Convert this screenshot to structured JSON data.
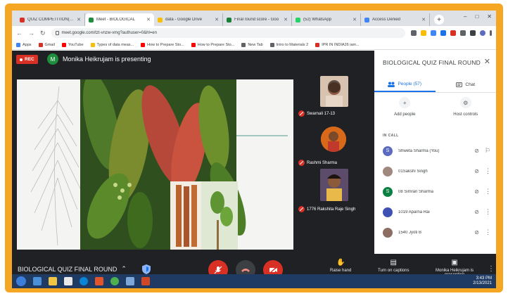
{
  "browser": {
    "tabs": [
      {
        "title": "QUIZ COMPETITION(UG)",
        "favicon_color": "#d93025",
        "active": false
      },
      {
        "title": "Meet - BIOLOGICAL",
        "favicon_color": "#1e8e3e",
        "active": true
      },
      {
        "title": "data - Google Drive",
        "favicon_color": "#fbbc04",
        "active": false
      },
      {
        "title": "Final round score - Goo",
        "favicon_color": "#188038",
        "active": false
      },
      {
        "title": "(52) WhatsApp",
        "favicon_color": "#25d366",
        "active": false
      },
      {
        "title": "Access Denied",
        "favicon_color": "#4285f4",
        "active": false
      }
    ],
    "new_tab_label": "+",
    "url": "meet.google.com/tzt-vnzw-vmg?authuser=0&hl=en",
    "bookmarks": [
      {
        "label": "Apps",
        "color": "#4285f4"
      },
      {
        "label": "Gmail",
        "color": "#d93025"
      },
      {
        "label": "YouTube",
        "color": "#ff0000"
      },
      {
        "label": "Types of data meas...",
        "color": "#fbbc04"
      },
      {
        "label": "How to Prepare Sto...",
        "color": "#ff0000"
      },
      {
        "label": "How to Prepare Sto...",
        "color": "#ff0000"
      },
      {
        "label": "New Tab",
        "color": "#5f6368"
      },
      {
        "label": "Intro to Materials 2",
        "color": "#5f6368"
      },
      {
        "label": "IPR IN INDIA26 iam...",
        "color": "#d93025"
      }
    ]
  },
  "meet": {
    "rec_label": "REC",
    "presenter_initial": "M",
    "presenter_text": "Monika Heikrujam is presenting",
    "participants_tiles": [
      {
        "name": "Swarnali 17-13"
      },
      {
        "name": "Rashmi Sharma"
      },
      {
        "name": "1776 Rakshita Raje Singh"
      }
    ],
    "meeting_name": "BIOLOGICAL QUIZ FINAL ROUND",
    "controls": {
      "raise_hand": "Raise hand",
      "captions": "Turn on captions",
      "presenting": "Monika Heikrujam is presenting"
    }
  },
  "panel": {
    "title": "BIOLOGICAL QUIZ FINAL ROUND",
    "tab_people": "People (57)",
    "tab_chat": "Chat",
    "add_people": "Add people",
    "host_controls": "Host controls",
    "section_label": "IN CALL",
    "people": [
      {
        "name": "Shweta Sharma (You)",
        "initial": "S",
        "color": "#5c6bc0"
      },
      {
        "name": "01Sakshi Singh",
        "initial": "",
        "color": "#a1887f"
      },
      {
        "name": "08 Simran Sharma",
        "initial": "S",
        "color": "#0b8043"
      },
      {
        "name": "1019 Aparna Rai",
        "initial": "",
        "color": "#3f51b5"
      },
      {
        "name": "1540 Jyoti B",
        "initial": "",
        "color": "#8d6e63"
      }
    ]
  },
  "taskbar": {
    "time": "3:43 PM",
    "date": "2/13/2021"
  }
}
